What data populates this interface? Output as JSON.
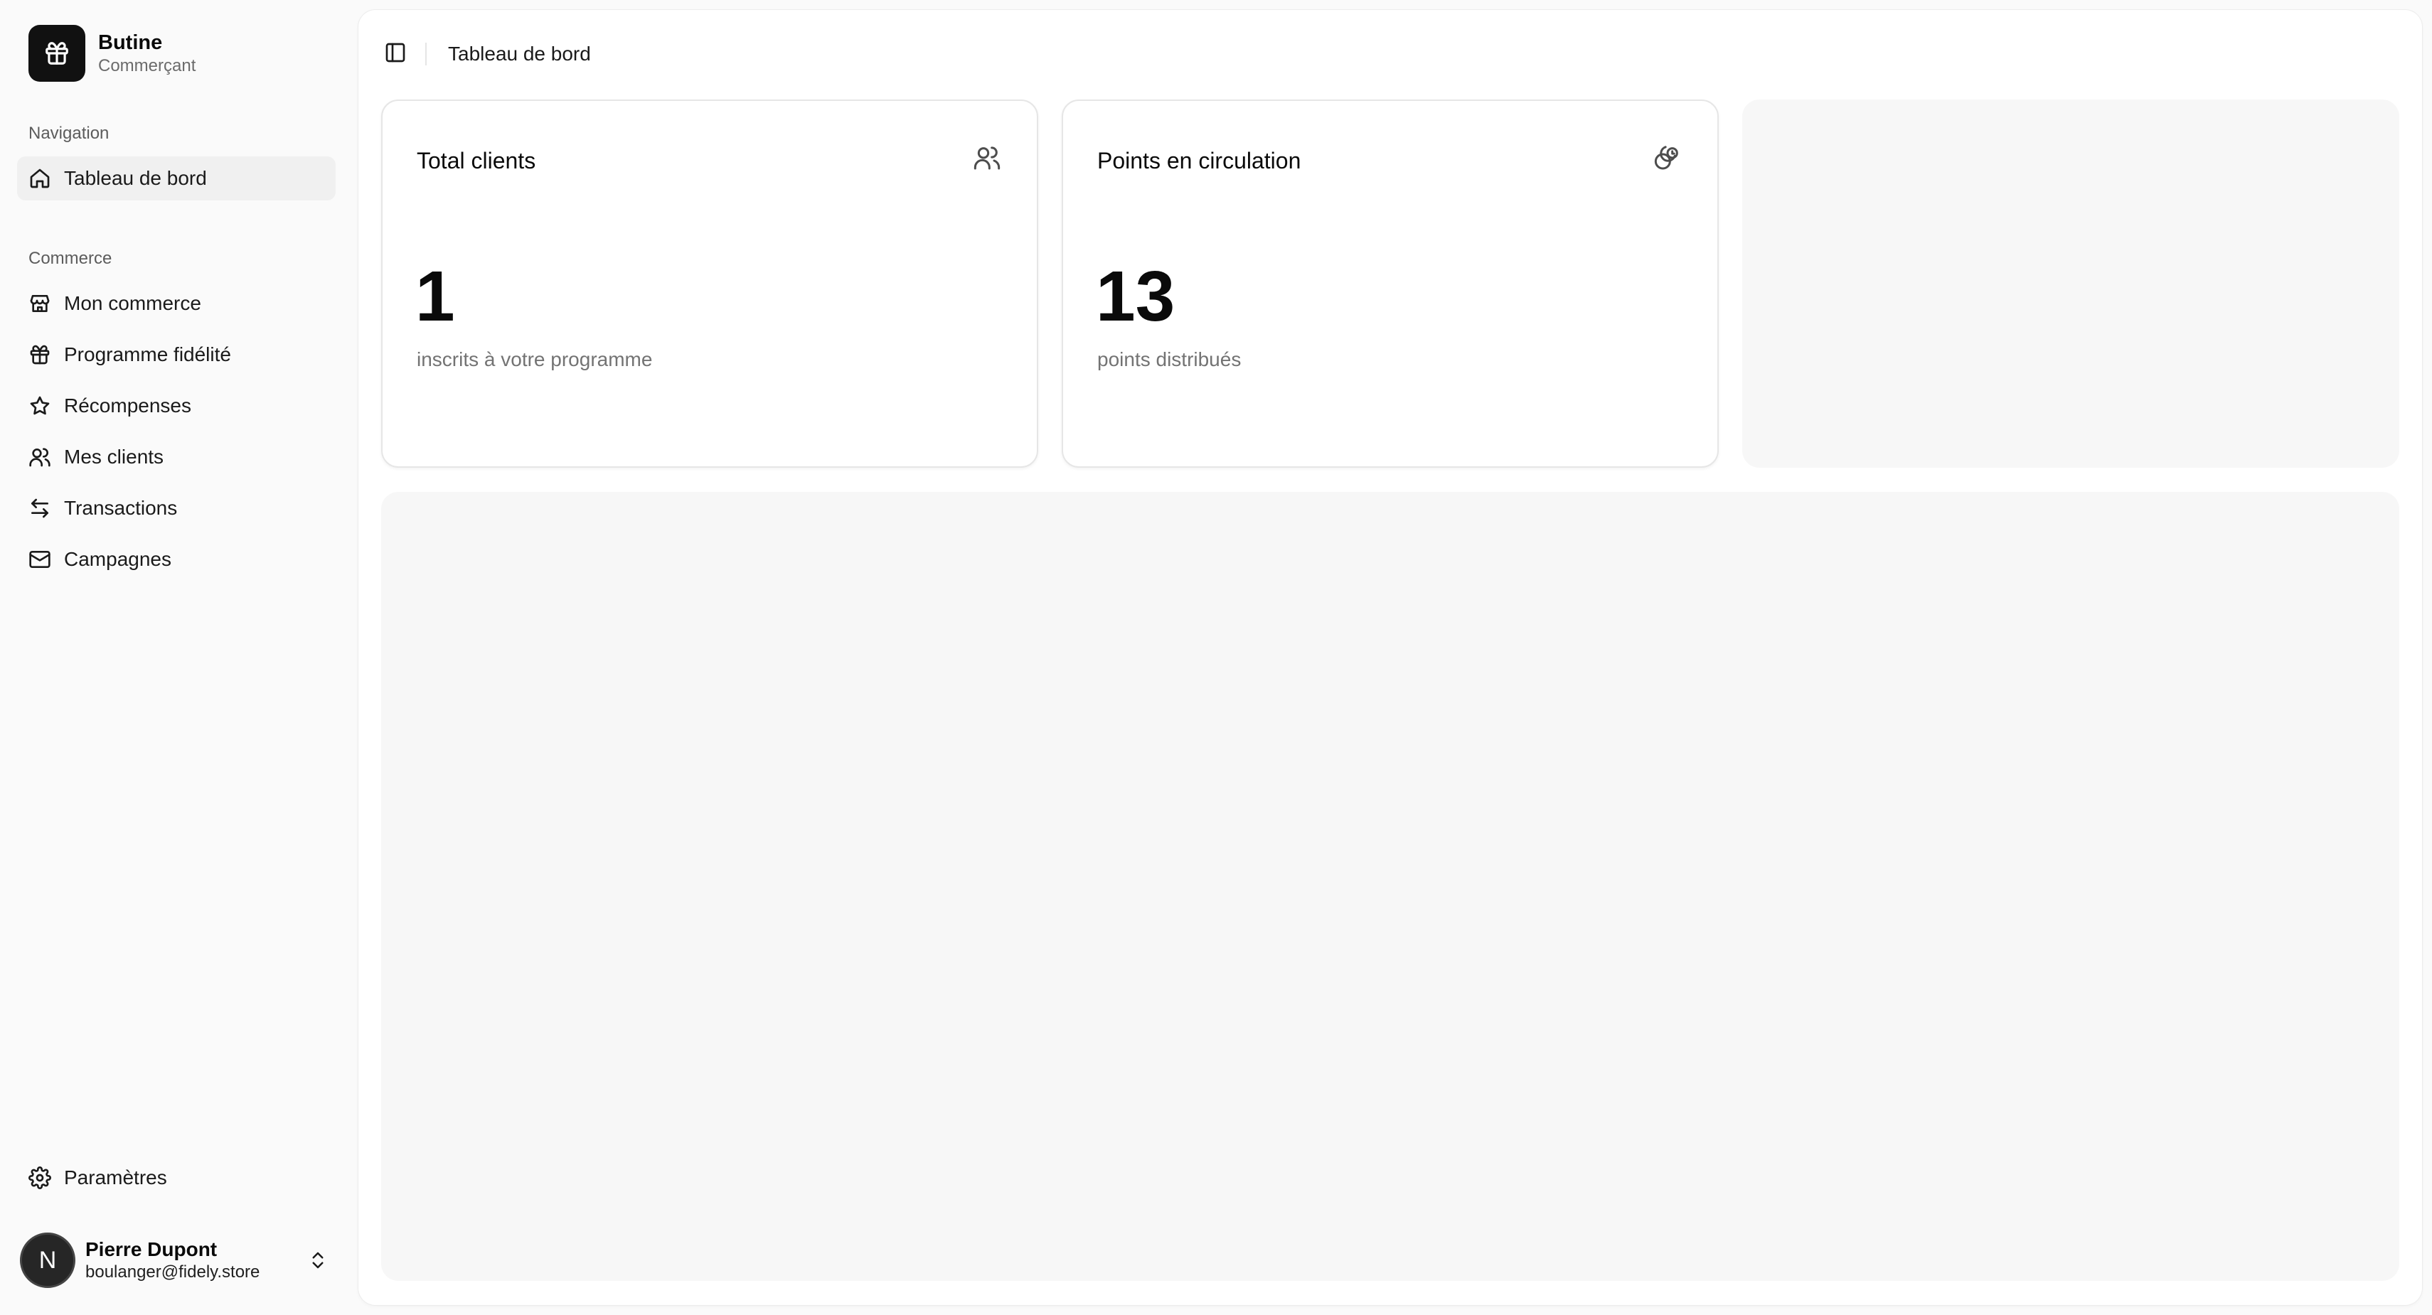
{
  "brand": {
    "name": "Butine",
    "role": "Commerçant"
  },
  "sidebar": {
    "groups": [
      {
        "label": "Navigation"
      },
      {
        "label": "Commerce"
      }
    ],
    "items": [
      {
        "label": "Tableau de bord",
        "icon": "home-icon"
      },
      {
        "label": "Mon commerce",
        "icon": "store-icon"
      },
      {
        "label": "Programme fidélité",
        "icon": "gift-icon"
      },
      {
        "label": "Récompenses",
        "icon": "star-icon"
      },
      {
        "label": "Mes clients",
        "icon": "users-icon"
      },
      {
        "label": "Transactions",
        "icon": "arrows-icon"
      },
      {
        "label": "Campagnes",
        "icon": "mail-icon"
      }
    ],
    "settings": {
      "label": "Paramètres",
      "icon": "gear-icon"
    }
  },
  "user": {
    "initial": "N",
    "name": "Pierre Dupont",
    "email": "boulanger@fidely.store"
  },
  "header": {
    "breadcrumb": "Tableau de bord"
  },
  "stats": [
    {
      "title": "Total clients",
      "value": "1",
      "caption": "inscrits à votre programme",
      "icon": "users-icon"
    },
    {
      "title": "Points en circulation",
      "value": "13",
      "caption": "points distribués",
      "icon": "coins-icon"
    }
  ]
}
